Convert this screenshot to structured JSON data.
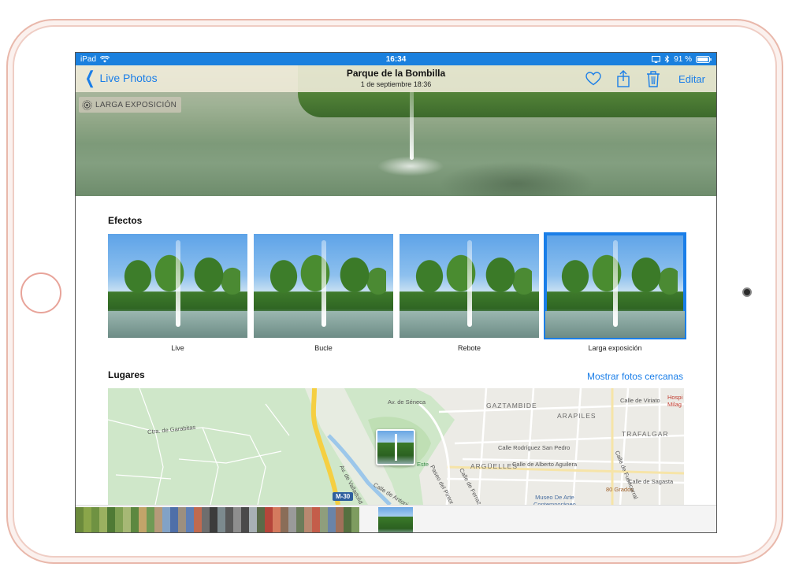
{
  "statusbar": {
    "carrier": "iPad",
    "time": "16:34",
    "battery": "91 %"
  },
  "navbar": {
    "back_label": "Live Photos",
    "title": "Parque de la Bombilla",
    "subtitle": "1 de septiembre  18:36",
    "edit_label": "Editar",
    "icons": [
      "heart-icon",
      "share-icon",
      "trash-icon"
    ]
  },
  "photo": {
    "badge_label": "LARGA EXPOSICIÓN"
  },
  "effects": {
    "title": "Efectos",
    "items": [
      {
        "label": "Live"
      },
      {
        "label": "Bucle"
      },
      {
        "label": "Rebote"
      },
      {
        "label": "Larga exposición"
      }
    ],
    "selected_index": 3
  },
  "places": {
    "title": "Lugares",
    "link_label": "Mostrar fotos cercanas",
    "map_labels": {
      "av_seneca": "Av. de Séneca",
      "gaztambide": "GAZTAMBIDE",
      "arapiles": "ARAPILES",
      "trafalgar": "TRAFALGAR",
      "arguelles": "ARGÜELLES",
      "calle_viriato": "Calle de Viriato",
      "calle_rodriguez": "Calle Rodríguez San Pedro",
      "calle_alberto": "Calle de Alberto Aguilera",
      "calle_sagasta": "Calle de Sagasta",
      "museo": "Museo De Arte\nContemporáneo",
      "ochenta_grados": "80 Grados",
      "hospital": "Hospi\nMilag",
      "av_valladolid": "Av. de Valladolid",
      "paseo_pintor": "Paseo del Pintor Rosales",
      "ctra_garabitas": "Ctra. de Garabitas",
      "m30": "M-30",
      "calle_fuencarral": "Calle de Fuencarral",
      "calle_ferraz": "Calle de Ferraz",
      "calle_antonio": "Calle de Antonio Machado",
      "este": "Este"
    }
  },
  "colors": {
    "accent": "#1a7ee8",
    "statusbar": "#1a80de"
  }
}
